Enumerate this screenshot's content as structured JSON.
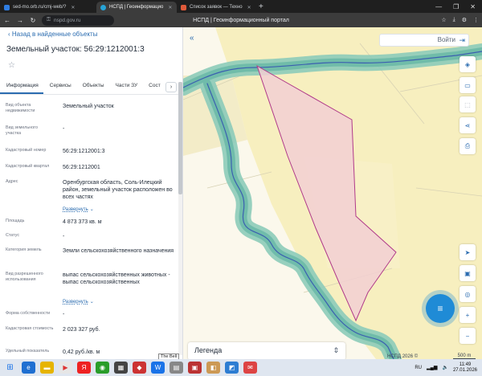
{
  "browser": {
    "tabs": [
      {
        "label": "sed-mo.orb.ru/cmj-web/?",
        "active": false
      },
      {
        "label": "НСПД | Геоинформацио",
        "active": true
      },
      {
        "label": "Список заявок — Техно",
        "active": false
      }
    ],
    "url": "nspd.gov.ru",
    "page_title": "НСПД | Геоинформационный портал"
  },
  "sidebar": {
    "back_label": "Назад в найденные объекты",
    "title": "Земельный участок: 56:29:1212001:3",
    "tabs": [
      "Информация",
      "Сервисы",
      "Объекты",
      "Части ЗУ",
      "Сост"
    ],
    "active_tab": "Информация",
    "fields": [
      {
        "key": "Вид объекта недвижимости",
        "value": "Земельный участок"
      },
      {
        "key": "Вид земельного участка",
        "value": "-"
      },
      {
        "key": "Кадастровый номер",
        "value": "56:29:1212001:3"
      },
      {
        "key": "Кадастровый квартал",
        "value": "56:29:1212001"
      },
      {
        "key": "Адрес",
        "value": "Оренбургская область, Соль-Илецкий район, земельный участок расположен во всех частях",
        "link": "Развернуть"
      },
      {
        "key": "Площадь",
        "value": "4 873 373 кв. м"
      },
      {
        "key": "Статус",
        "value": "-"
      },
      {
        "key": "Категория земель",
        "value": "Земли сельскохозяйственного назначения"
      },
      {
        "key": "Вид разрешенного использования",
        "value": "выпас сельскохозяйственных животных - выпас сельскохозяйственных",
        "link": "Развернуть"
      },
      {
        "key": "Форма собственности",
        "value": "-"
      },
      {
        "key": "Кадастровая стоимость",
        "value": "2 023 327 руб."
      },
      {
        "key": "Удельный показатель",
        "value": "0,42 руб./кв. м"
      }
    ]
  },
  "map": {
    "login_label": "Войти",
    "legend_label": "Легенда",
    "attribution": "НСПД 2026 ©",
    "scale_label": "500 m",
    "colors": {
      "parcel_fill": "#f2cfd2",
      "parcel_stroke": "#b03a8a",
      "river_buffer": "#7fc1b0",
      "river": "#3b5fb0",
      "land": "#f7efbf"
    },
    "tooltip": "The Bell"
  },
  "taskbar": {
    "lang": "RU",
    "time": "11:49",
    "date": "27.01.2026"
  }
}
